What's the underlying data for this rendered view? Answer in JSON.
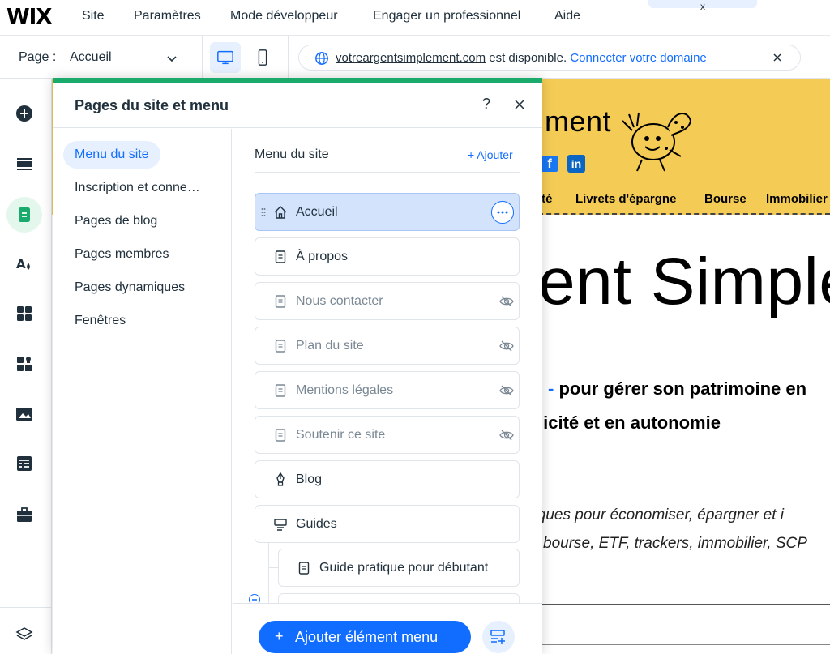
{
  "topbar": {
    "logo": "WIX",
    "menu": [
      "Site",
      "Paramètres",
      "Mode développeur",
      "Engager un professionnel",
      "Aide"
    ],
    "tab_stub": "x"
  },
  "pagebar": {
    "page_label": "Page :",
    "page_value": "Accueil",
    "domain": {
      "name": "votreargentsimplement.com",
      "status": " est disponible.",
      "connect": "Connecter votre domaine"
    }
  },
  "rail": {
    "items": [
      {
        "name": "add-elements",
        "icon": "plus-circle-icon"
      },
      {
        "name": "add-section",
        "icon": "section-icon"
      },
      {
        "name": "pages-menu",
        "icon": "page-icon",
        "active": true
      },
      {
        "name": "site-design",
        "icon": "design-icon"
      },
      {
        "name": "add-apps",
        "icon": "apps-icon"
      },
      {
        "name": "business-apps",
        "icon": "puzzle-icon"
      },
      {
        "name": "media",
        "icon": "image-icon"
      },
      {
        "name": "cms",
        "icon": "table-icon"
      },
      {
        "name": "portfolio",
        "icon": "briefcase-icon"
      },
      {
        "name": "layers",
        "icon": "layers-icon"
      }
    ]
  },
  "canvas": {
    "logo_text": "ment",
    "nav": [
      "ité",
      "Livrets d'épargne",
      "Bourse",
      "Immobilier"
    ],
    "hero_title": "ent Simple",
    "sub1_dash": "-",
    "sub1": " pour gérer son patrimoine en",
    "sub2": "licité et en autonomie",
    "para1": "giques pour économiser, épargner et i",
    "para2": "bourse, ETF, trackers, immobilier, SCP"
  },
  "panel": {
    "title": "Pages du site et menu",
    "help": "?",
    "nav": [
      {
        "label": "Menu du site",
        "active": true
      },
      {
        "label": "Inscription et conne…",
        "active": false
      },
      {
        "label": "Pages de blog",
        "active": false
      },
      {
        "label": "Pages membres",
        "active": false
      },
      {
        "label": "Pages dynamiques",
        "active": false
      },
      {
        "label": "Fenêtres",
        "active": false
      }
    ],
    "content": {
      "title": "Menu du site",
      "add_label": "+ Ajouter",
      "pages": [
        {
          "label": "Accueil",
          "icon": "home-icon",
          "hidden": false,
          "selected": true
        },
        {
          "label": "À propos",
          "icon": "page-icon",
          "hidden": false
        },
        {
          "label": "Nous contacter",
          "icon": "page-icon",
          "hidden": true
        },
        {
          "label": "Plan du site",
          "icon": "page-icon",
          "hidden": true
        },
        {
          "label": "Mentions légales",
          "icon": "page-icon",
          "hidden": true
        },
        {
          "label": "Soutenir ce site",
          "icon": "page-icon",
          "hidden": true
        },
        {
          "label": "Blog",
          "icon": "pen-icon",
          "hidden": false
        },
        {
          "label": "Guides",
          "icon": "folder-menu-icon",
          "hidden": false,
          "expanded": true
        },
        {
          "label": "Guide pratique pour débutant",
          "icon": "page-icon",
          "hidden": false,
          "child": true
        }
      ]
    },
    "footer": {
      "plus": "+",
      "add_menu_item": "Ajouter élément menu"
    }
  },
  "colors": {
    "accent": "#116dff",
    "panel_top": "#1aaa6c",
    "selected_row": "#d3e3fc",
    "site_header": "#f4cc55"
  }
}
